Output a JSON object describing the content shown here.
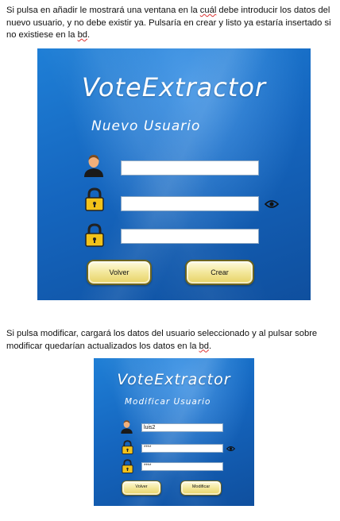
{
  "intro_text": {
    "before_word": "Si pulsa en añadir le mostrará una ventana en la ",
    "misspelled_word": "cuál",
    "after_word": " debe introducir los datos del nuevo usuario, y no debe existir ya. Pulsaría en crear y listo ya estaría insertado si no existiese en la ",
    "db_word": "bd",
    "end": "."
  },
  "modify_text": {
    "before": "Si pulsa modificar, cargará los datos del usuario seleccionado y al pulsar sobre modificar quedarían actualizados los datos en la ",
    "db_word": "bd",
    "end": "."
  },
  "new_user_window": {
    "app_title": "VoteExtractor",
    "subtitle": "Nuevo Usuario",
    "username_value": "",
    "password_value": "",
    "confirm_value": "",
    "back_button": "Volver",
    "create_button": "Crear"
  },
  "modify_user_window": {
    "app_title": "VoteExtractor",
    "subtitle": "Modificar Usuario",
    "username_value": "luis2",
    "password_value": "****",
    "confirm_value": "****",
    "back_button": "Volver",
    "modify_button": "Modificar"
  },
  "icons": [
    "user-icon",
    "lock-icon",
    "eye-icon"
  ],
  "colors": {
    "window_bg": "#1566bf",
    "button_fill": "#f3e79b",
    "button_border": "#6b6420"
  }
}
